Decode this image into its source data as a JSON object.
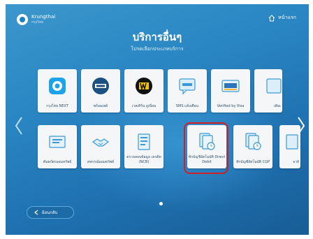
{
  "header": {
    "bank_name": "Krungthai",
    "bank_sub": "กรุงไทย",
    "home_label": "หน้าแรก"
  },
  "page": {
    "title": "บริการอื่นๆ",
    "subtitle": "โปรดเลือกประเภทบริการ"
  },
  "tiles_row1": [
    {
      "label": "กรุงไทย NEXT",
      "icon": "krungthai-next-icon"
    },
    {
      "label": "พร้อมเพย์",
      "icon": "promptpay-icon"
    },
    {
      "label": "เวสเทิร์น ยูเนี่ยน",
      "icon": "western-union-icon"
    },
    {
      "label": "SMS แจ้งเตือน",
      "icon": "sms-icon"
    },
    {
      "label": "Verified by Visa",
      "icon": "visa-icon"
    }
  ],
  "tiles_row2": [
    {
      "label": "พันธบัตรออมทรัพย์",
      "icon": "bond-icon"
    },
    {
      "label": "สหกรณ์ออมทรัพย์",
      "icon": "handshake-icon"
    },
    {
      "label": "ตรวจสอบข้อมูล เครดิต (NCB)",
      "icon": "ncb-icon"
    },
    {
      "label": "หักบัญชีอัตโนมัติ Direct Debit",
      "icon": "direct-debit-icon"
    },
    {
      "label": "หักบัญชีอัตโนมัติ CGP",
      "icon": "cgp-icon"
    }
  ],
  "partial_tiles": {
    "row1_label": "เติมเ",
    "row2_label": "อายั"
  },
  "footer": {
    "back_label": "ย้อนกลับ"
  },
  "colors": {
    "highlight": "#d21f27",
    "brand": "#1b7fc4"
  }
}
